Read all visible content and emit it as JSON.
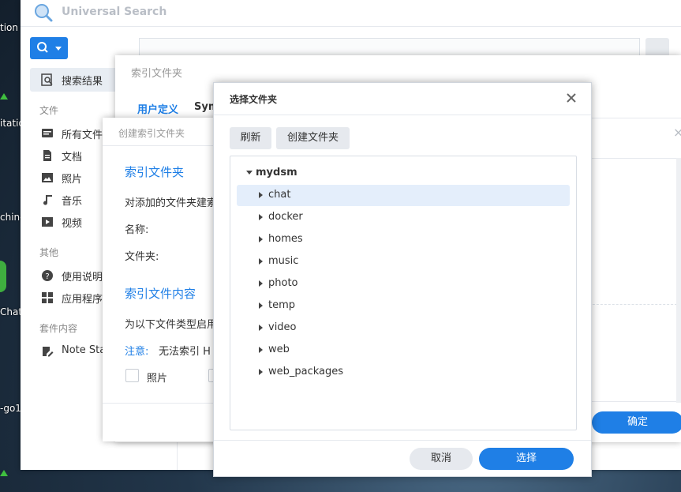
{
  "desktop": {
    "labels": [
      "tion",
      "itatio",
      "chine",
      "Chat",
      "-go1"
    ]
  },
  "universal_search": {
    "title": "Universal Search",
    "sidebar": {
      "search_results": "搜索结果",
      "section_files": "文件",
      "items_files": [
        "所有文件",
        "文档",
        "照片",
        "音乐",
        "视频"
      ],
      "section_other": "其他",
      "items_other": [
        "使用说明",
        "应用程序"
      ],
      "section_plugins": "套件内容",
      "items_plugins": [
        "Note Sta"
      ]
    }
  },
  "index_dialog": {
    "title": "索引文件夹",
    "tabs": [
      "用户定义",
      "Sym"
    ],
    "confirm": "确定"
  },
  "create_dialog": {
    "title": "创建索引文件夹",
    "section_folder": "索引文件夹",
    "desc": "对添加的文件夹建索",
    "name_label": "名称:",
    "folder_label": "文件夹:",
    "section_content": "索引文件内容",
    "content_desc": "为以下文件类型启用",
    "note_label": "注意:",
    "note_text": "无法索引 H",
    "checkbox_photo": "照片"
  },
  "select_dialog": {
    "title": "选择文件夹",
    "refresh": "刷新",
    "create_folder": "创建文件夹",
    "root": "mydsm",
    "folders": [
      "chat",
      "docker",
      "homes",
      "music",
      "photo",
      "temp",
      "video",
      "web",
      "web_packages"
    ],
    "selected_folder": "chat",
    "cancel": "取消",
    "select": "选择"
  },
  "colors": {
    "accent": "#1f7fe6"
  }
}
